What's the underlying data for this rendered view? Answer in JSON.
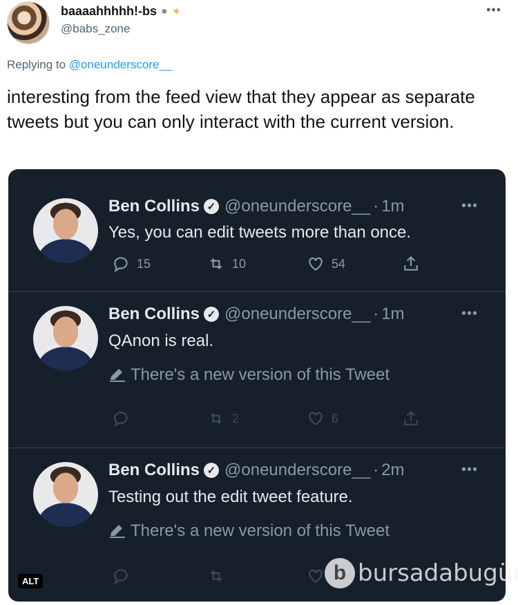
{
  "outer": {
    "name": "baaaahhhhh!-bs",
    "name_emoji": [
      "ghost-emoji",
      "sparkles-emoji"
    ],
    "handle": "@babs_zone",
    "more_label": "•••",
    "replying_prefix": "Replying to",
    "replying_handle": "@oneunderscore__",
    "text": "interesting from the feed view that they appear as separate tweets but you can only interact with the current version."
  },
  "embedded": {
    "tweets": [
      {
        "name": "Ben Collins",
        "handle": "@oneunderscore__",
        "time": "1m",
        "text": "Yes, you can edit tweets more than once.",
        "reply_count": "15",
        "retweet_count": "10",
        "like_count": "54",
        "more_label": "•••"
      },
      {
        "name": "Ben Collins",
        "handle": "@oneunderscore__",
        "time": "1m",
        "text": "QAnon is real.",
        "note": "There's a new version of this Tweet",
        "reply_count": "",
        "retweet_count": "2",
        "like_count": "6",
        "more_label": "•••"
      },
      {
        "name": "Ben Collins",
        "handle": "@oneunderscore__",
        "time": "2m",
        "text": "Testing out the edit tweet feature.",
        "note": "There's a new version of this Tweet",
        "more_label": "•••"
      }
    ],
    "alt_label": "ALT"
  },
  "watermark": {
    "logo": "b",
    "text": "bursadabugün"
  },
  "colors": {
    "dark_bg": "#15202b",
    "link": "#1d9bf0",
    "muted": "#8b98a5"
  }
}
